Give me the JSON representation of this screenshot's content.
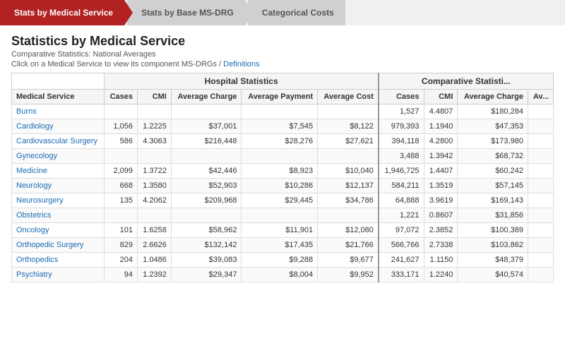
{
  "nav": {
    "items": [
      {
        "label": "Stats by Medical Service",
        "active": true
      },
      {
        "label": "Stats by Base MS-DRG",
        "active": false
      },
      {
        "label": "Categorical Costs",
        "active": false
      }
    ]
  },
  "header": {
    "title": "Statistics by Medical Service",
    "subtitle": "Comparative Statistics: National Averages",
    "instruction": "Click on a Medical Service to view its component MS-DRGs /",
    "definitions_link": "Definitions"
  },
  "table": {
    "group_headers": {
      "hospital": "Hospital Statistics",
      "comparative": "Comparative Statisti..."
    },
    "columns": [
      "Medical Service",
      "Cases",
      "CMI",
      "Average Charge",
      "Average Payment",
      "Average Cost",
      "Cases",
      "CMI",
      "Average Charge",
      "Av..."
    ],
    "rows": [
      {
        "service": "Burns",
        "cases": "",
        "cmi": "",
        "avg_charge": "",
        "avg_payment": "",
        "avg_cost": "",
        "nat_cases": "1,527",
        "nat_cmi": "4.4807",
        "nat_charge": "$180,284",
        "nat_extra": ""
      },
      {
        "service": "Cardiology",
        "cases": "1,056",
        "cmi": "1.2225",
        "avg_charge": "$37,001",
        "avg_payment": "$7,545",
        "avg_cost": "$8,122",
        "nat_cases": "979,393",
        "nat_cmi": "1.1940",
        "nat_charge": "$47,353",
        "nat_extra": ""
      },
      {
        "service": "Cardiovascular Surgery",
        "cases": "586",
        "cmi": "4.3063",
        "avg_charge": "$216,448",
        "avg_payment": "$28,276",
        "avg_cost": "$27,621",
        "nat_cases": "394,118",
        "nat_cmi": "4.2800",
        "nat_charge": "$173,980",
        "nat_extra": ""
      },
      {
        "service": "Gynecology",
        "cases": "",
        "cmi": "",
        "avg_charge": "",
        "avg_payment": "",
        "avg_cost": "",
        "nat_cases": "3,488",
        "nat_cmi": "1.3942",
        "nat_charge": "$68,732",
        "nat_extra": ""
      },
      {
        "service": "Medicine",
        "cases": "2,099",
        "cmi": "1.3722",
        "avg_charge": "$42,446",
        "avg_payment": "$8,923",
        "avg_cost": "$10,040",
        "nat_cases": "1,946,725",
        "nat_cmi": "1.4407",
        "nat_charge": "$60,242",
        "nat_extra": ""
      },
      {
        "service": "Neurology",
        "cases": "668",
        "cmi": "1.3580",
        "avg_charge": "$52,903",
        "avg_payment": "$10,286",
        "avg_cost": "$12,137",
        "nat_cases": "584,211",
        "nat_cmi": "1.3519",
        "nat_charge": "$57,145",
        "nat_extra": ""
      },
      {
        "service": "Neurosurgery",
        "cases": "135",
        "cmi": "4.2062",
        "avg_charge": "$209,968",
        "avg_payment": "$29,445",
        "avg_cost": "$34,786",
        "nat_cases": "64,888",
        "nat_cmi": "3.9619",
        "nat_charge": "$169,143",
        "nat_extra": ""
      },
      {
        "service": "Obstetrics",
        "cases": "",
        "cmi": "",
        "avg_charge": "",
        "avg_payment": "",
        "avg_cost": "",
        "nat_cases": "1,221",
        "nat_cmi": "0.8607",
        "nat_charge": "$31,856",
        "nat_extra": ""
      },
      {
        "service": "Oncology",
        "cases": "101",
        "cmi": "1.6258",
        "avg_charge": "$58,962",
        "avg_payment": "$11,901",
        "avg_cost": "$12,080",
        "nat_cases": "97,072",
        "nat_cmi": "2.3852",
        "nat_charge": "$100,389",
        "nat_extra": ""
      },
      {
        "service": "Orthopedic Surgery",
        "cases": "829",
        "cmi": "2.6626",
        "avg_charge": "$132,142",
        "avg_payment": "$17,435",
        "avg_cost": "$21,766",
        "nat_cases": "566,766",
        "nat_cmi": "2.7338",
        "nat_charge": "$103,862",
        "nat_extra": ""
      },
      {
        "service": "Orthopedics",
        "cases": "204",
        "cmi": "1.0486",
        "avg_charge": "$39,083",
        "avg_payment": "$9,288",
        "avg_cost": "$9,677",
        "nat_cases": "241,627",
        "nat_cmi": "1.1150",
        "nat_charge": "$48,379",
        "nat_extra": ""
      },
      {
        "service": "Psychiatry",
        "cases": "94",
        "cmi": "1.2392",
        "avg_charge": "$29,347",
        "avg_payment": "$8,004",
        "avg_cost": "$9,952",
        "nat_cases": "333,171",
        "nat_cmi": "1.2240",
        "nat_charge": "$40,574",
        "nat_extra": ""
      }
    ]
  }
}
